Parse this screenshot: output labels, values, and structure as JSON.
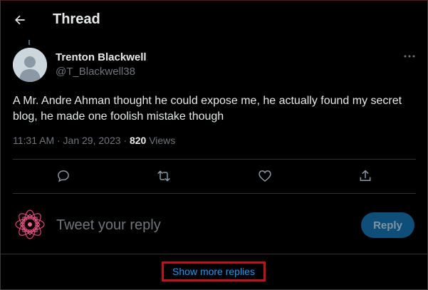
{
  "header": {
    "title": "Thread"
  },
  "tweet": {
    "author_name": "Trenton Blackwell",
    "author_handle": "@T_Blackwell38",
    "text": "A Mr. Andre Ahman thought he could expose me, he actually found my secret blog, he made one foolish mistake though",
    "time": "11:31 AM · Jan 29, 2023 · ",
    "views_count": "820",
    "views_label": " Views"
  },
  "composer": {
    "placeholder": "Tweet your reply",
    "button_label": "Reply"
  },
  "show_more_label": "Show more replies",
  "colors": {
    "accent": "#1d9bf0",
    "reply_button_bg": "#0f4e78",
    "highlight_border": "#c0121b",
    "muted": "#71767b"
  }
}
